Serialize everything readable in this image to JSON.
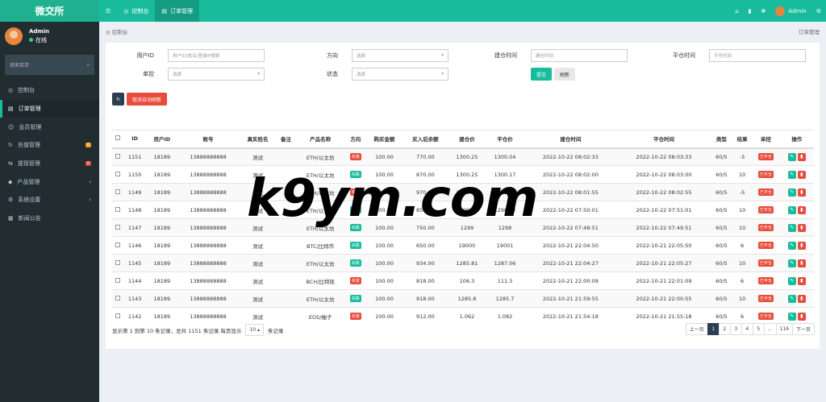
{
  "app": {
    "logo": "微交所"
  },
  "topbar": {
    "tabs": [
      "控制台",
      "订单管理"
    ],
    "user": "Admin"
  },
  "sidebar": {
    "user": "Admin",
    "status": "在线",
    "search_placeholder": "搜索菜单",
    "items": [
      {
        "label": "控制台"
      },
      {
        "label": "订单管理"
      },
      {
        "label": "会员管理"
      },
      {
        "label": "充值管理",
        "badge": "0"
      },
      {
        "label": "提现管理",
        "badge": "0"
      },
      {
        "label": "产品管理"
      },
      {
        "label": "系统设置"
      },
      {
        "label": "新闻公告"
      }
    ]
  },
  "breadcrumb": {
    "home": "控制台",
    "current": "订单管理"
  },
  "filters": {
    "uid_label": "用户ID",
    "uid_ph": "用户ID|姓名|登录IP搜索",
    "dir_label": "方向",
    "dir_val": "选择",
    "open_label": "建仓时间",
    "open_ph": "建仓时间",
    "close_label": "平仓时间",
    "close_ph": "平仓时间",
    "ctrl_label": "单控",
    "ctrl_val": "选择",
    "status_label": "状态",
    "status_val": "选择",
    "submit": "提交",
    "reset": "刷新"
  },
  "toolbar": {
    "refresh_icon": "refresh-icon",
    "cancel_auto": "取消自动刷新"
  },
  "table": {
    "headers": [
      "ID",
      "用户ID",
      "账号",
      "真实姓名",
      "备注",
      "产品名称",
      "方向",
      "购买金额",
      "买入后余额",
      "建仓价",
      "平仓价",
      "建仓时间",
      "平仓时间",
      "类型",
      "结果",
      "单控",
      "操作"
    ],
    "rows": [
      [
        "1151",
        "18189",
        "13888888888",
        "测试",
        "",
        "ETH/以太坊",
        "买涨",
        "100.00",
        "770.00",
        "1300.25",
        "1300.04",
        "2022-10-22 08:02:33",
        "2022-10-22 08:03:33",
        "60/5",
        "-5",
        "已平仓"
      ],
      [
        "1150",
        "18189",
        "13888888888",
        "测试",
        "",
        "ETH/以太坊",
        "买跌",
        "100.00",
        "870.00",
        "1300.25",
        "1300.17",
        "2022-10-22 08:02:00",
        "2022-10-22 08:03:00",
        "60/5",
        "10",
        "已平仓"
      ],
      [
        "1149",
        "18189",
        "13888888888",
        "测试",
        "",
        "ETH/以太坊",
        "买涨",
        "100.00",
        "970.00",
        "1300.24",
        "1299.91",
        "2022-10-22 08:01:55",
        "2022-10-22 08:02:55",
        "60/5",
        "-5",
        "已平仓"
      ],
      [
        "1148",
        "18189",
        "13888888888",
        "测试",
        "",
        "ETH/以太坊",
        "买跌",
        "100.00",
        "850.00",
        "1299.01",
        "1298.82",
        "2022-10-22 07:50:01",
        "2022-10-22 07:51:01",
        "60/5",
        "10",
        "已平仓"
      ],
      [
        "1147",
        "18189",
        "13888888888",
        "测试",
        "",
        "ETH/以太坊",
        "买跌",
        "100.00",
        "750.00",
        "1299",
        "1298",
        "2022-10-22 07:48:51",
        "2022-10-22 07:49:51",
        "60/5",
        "10",
        "已平仓"
      ],
      [
        "1146",
        "18189",
        "13888888888",
        "测试",
        "",
        "BTC/比特币",
        "买跌",
        "100.00",
        "650.00",
        "19000",
        "19001",
        "2022-10-21 22:04:50",
        "2022-10-21 22:05:50",
        "60/5",
        "6",
        "已平仓"
      ],
      [
        "1145",
        "18189",
        "13888888888",
        "测试",
        "",
        "ETH/以太坊",
        "买跌",
        "100.00",
        "934.00",
        "1285.81",
        "1287.06",
        "2022-10-21 22:04:27",
        "2022-10-21 22:05:27",
        "60/5",
        "10",
        "已平仓"
      ],
      [
        "1144",
        "18189",
        "13888888888",
        "测试",
        "",
        "BCH/比特现",
        "买涨",
        "100.00",
        "818.00",
        "106.3",
        "111.3",
        "2022-10-21 22:00:09",
        "2022-10-21 22:01:09",
        "60/5",
        "6",
        "已平仓"
      ],
      [
        "1143",
        "18189",
        "13888888888",
        "测试",
        "",
        "ETH/以太坊",
        "买跌",
        "100.00",
        "918.00",
        "1285.8",
        "1285.7",
        "2022-10-21 21:59:55",
        "2022-10-21 22:00:55",
        "60/5",
        "10",
        "已平仓"
      ],
      [
        "1142",
        "18189",
        "13888888888",
        "测试",
        "",
        "EOS/柚子",
        "买涨",
        "100.00",
        "912.00",
        "1.062",
        "1.082",
        "2022-10-21 21:54:18",
        "2022-10-21 21:55:18",
        "60/5",
        "6",
        "已平仓"
      ]
    ]
  },
  "footer": {
    "info": "显示第 1 到第 10 条记录，总共 1151 条记录 每页显示",
    "per_page": "10",
    "suffix": "条记录"
  },
  "pager": [
    "上一页",
    "1",
    "2",
    "3",
    "4",
    "5",
    "...",
    "116",
    "下一页"
  ],
  "watermark": "k9ym.com"
}
